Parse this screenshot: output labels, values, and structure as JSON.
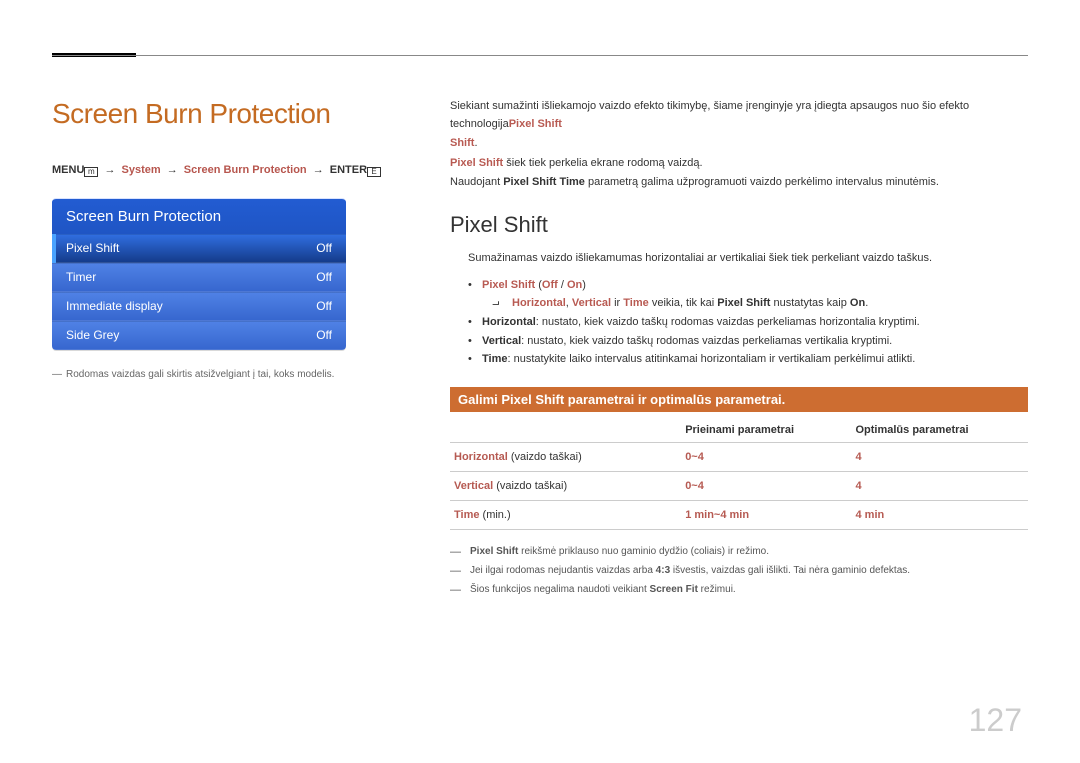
{
  "heading": "Screen Burn Protection",
  "breadcrumb": {
    "menu": "MENU",
    "icon1": "m",
    "arrow": "→",
    "system": "System",
    "sbp": "Screen Burn Protection",
    "enter": "ENTER",
    "icon2": "E"
  },
  "panel": {
    "title": "Screen Burn Protection",
    "rows": [
      {
        "label": "Pixel Shift",
        "value": "Off"
      },
      {
        "label": "Timer",
        "value": "Off"
      },
      {
        "label": "Immediate display",
        "value": "Off"
      },
      {
        "label": "Side Grey",
        "value": "Off"
      }
    ]
  },
  "left_footnote": "Rodomas vaizdas gali skirtis atsižvelgiant į tai, koks modelis.",
  "intro": {
    "p1a": "Siekiant sumažinti išliekamojo vaizdo efekto tikimybę, šiame įrenginyje yra įdiegta apsaugos nuo šio efekto technologija",
    "p1b": "Pixel Shift",
    "period": ".",
    "p2a": "Pixel Shift",
    "p2b": " šiek tiek perkelia ekrane rodomą vaizdą.",
    "p3a": "Naudojant ",
    "p3b": "Pixel Shift Time",
    "p3c": " parametrą galima užprogramuoti vaizdo perkėlimo intervalus minutėmis."
  },
  "pixel_shift": {
    "title": "Pixel Shift",
    "desc": "Sumažinamas vaizdo išliekamumas horizontaliai ar vertikaliai šiek tiek perkeliant vaizdo taškus.",
    "bullet1": {
      "a": "Pixel Shift",
      "b": " (",
      "c": "Off",
      "d": " / ",
      "e": "On",
      "f": ")"
    },
    "sub": {
      "a": "Horizontal",
      "c1": ", ",
      "b": "Vertical",
      "c2": " ir ",
      "c": "Time",
      "d": " veikia, tik kai ",
      "e": "Pixel Shift",
      "f": " nustatytas kaip ",
      "g": "On",
      "p": "."
    },
    "b2": {
      "a": "Horizontal",
      "b": ": nustato, kiek vaizdo taškų rodomas vaizdas perkeliamas horizontalia kryptimi."
    },
    "b3": {
      "a": "Vertical",
      "b": ": nustato, kiek vaizdo taškų rodomas vaizdas perkeliamas vertikalia kryptimi."
    },
    "b4": {
      "a": "Time",
      "b": ": nustatykite laiko intervalus atitinkamai horizontaliam ir vertikaliam perkėlimui atlikti."
    }
  },
  "orange_heading": "Galimi Pixel Shift parametrai ir optimalūs parametrai.",
  "table": {
    "h1": "Prieinami parametrai",
    "h2": "Optimalūs parametrai",
    "rows": [
      {
        "label": "Horizontal",
        "unit": " (vaizdo taškai)",
        "avail": "0~4",
        "opt": "4"
      },
      {
        "label": "Vertical",
        "unit": " (vaizdo taškai)",
        "avail": "0~4",
        "opt": "4"
      },
      {
        "label": "Time",
        "unit": " (min.)",
        "avail": "1 min~4 min",
        "opt": "4 min"
      }
    ]
  },
  "bottom_notes": {
    "n1a": "Pixel Shift",
    "n1b": " reikšmė priklauso nuo gaminio dydžio (coliais) ir režimo.",
    "n2a": "Jei ilgai rodomas nejudantis vaizdas arba ",
    "n2b": "4:3",
    "n2c": " išvestis, vaizdas gali išlikti. Tai nėra gaminio defektas.",
    "n3a": "Šios funkcijos negalima naudoti veikiant ",
    "n3b": "Screen Fit",
    "n3c": " režimui."
  },
  "page_number": "127"
}
